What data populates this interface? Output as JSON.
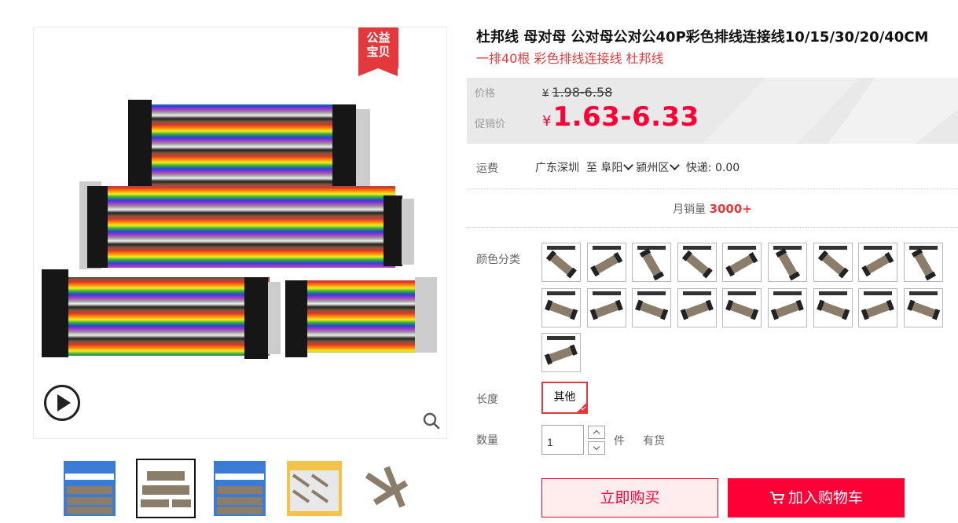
{
  "gallery": {
    "badge_line1": "公益",
    "badge_line2": "宝贝",
    "play_icon": "play-circle-icon",
    "zoom_icon": "magnifier-icon",
    "thumbnail_count": 5,
    "active_thumbnail": 2
  },
  "product": {
    "title": "杜邦线 母对母 公对母公对公40P彩色排线连接线10/15/30/20/40CM",
    "subtitle": "一排40根 彩色排线连接线 杜邦线"
  },
  "price": {
    "label": "价格",
    "currency": "¥",
    "original": "1.98-6.58",
    "promo_label": "促销价",
    "promo": "1.63-6.33"
  },
  "shipping": {
    "label": "运费",
    "origin": "广东深圳",
    "to": "至",
    "city": "阜阳",
    "district": "颍州区",
    "express": "快递: 0.00"
  },
  "sales": {
    "label": "月销量",
    "value": "3000+"
  },
  "color": {
    "label": "颜色分类",
    "option_count": 19
  },
  "length": {
    "label": "长度",
    "selected": "其他"
  },
  "quantity": {
    "label": "数量",
    "value": "1",
    "unit": "件",
    "stock": "有货"
  },
  "actions": {
    "buy_now": "立即购买",
    "add_to_cart": "加入购物车"
  },
  "colors": {
    "accent": "#ff0036",
    "badge": "#e4393c"
  }
}
